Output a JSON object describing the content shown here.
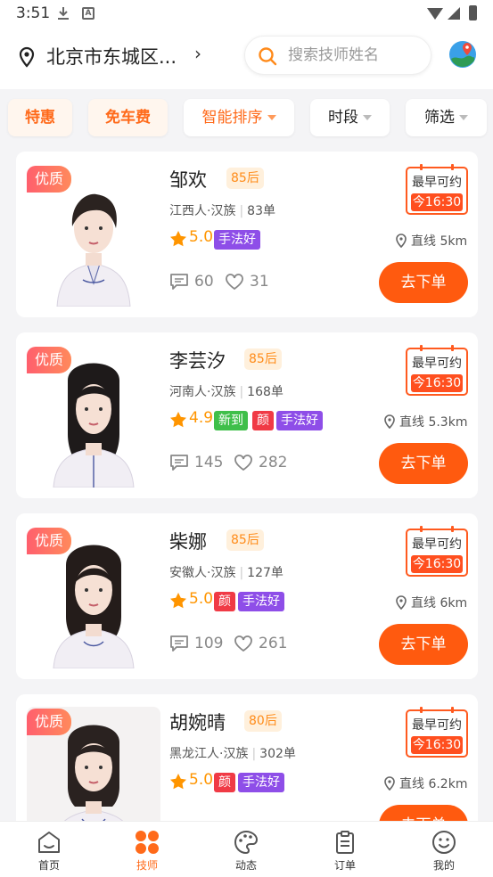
{
  "status_bar": {
    "time": "3:51"
  },
  "header": {
    "location": "北京市东城区...",
    "search_placeholder": "搜索技师姓名"
  },
  "filters": [
    {
      "label": "特惠",
      "type": "hot"
    },
    {
      "label": "免车费",
      "type": "hot"
    },
    {
      "label": "智能排序",
      "type": "sort"
    },
    {
      "label": "时段",
      "type": "dropdown"
    },
    {
      "label": "筛选",
      "type": "dropdown"
    }
  ],
  "colors": {
    "accent": "#ff5a0f",
    "star": "#ff9500",
    "purple_tag": "#8e4ee8",
    "red_tag": "#f03a45",
    "green_tag": "#3fbf4a"
  },
  "therapists": [
    {
      "badge": "优质",
      "name": "邹欢",
      "age_group": "85后",
      "origin": "江西人·汉族",
      "orders": "83单",
      "rating": "5.0",
      "tags": [
        {
          "text": "手法好",
          "color": "purple"
        }
      ],
      "avail_title": "最早可约",
      "avail_time": "今16:30",
      "distance": "直线 5km",
      "comments": "60",
      "likes": "31",
      "order_label": "去下单"
    },
    {
      "badge": "优质",
      "name": "李芸汐",
      "age_group": "85后",
      "origin": "河南人·汉族",
      "orders": "168单",
      "rating": "4.9",
      "tags": [
        {
          "text": "新到",
          "color": "green"
        },
        {
          "text": "颜",
          "color": "red"
        },
        {
          "text": "手法好",
          "color": "purple"
        }
      ],
      "avail_title": "最早可约",
      "avail_time": "今16:30",
      "distance": "直线 5.3km",
      "comments": "145",
      "likes": "282",
      "order_label": "去下单"
    },
    {
      "badge": "优质",
      "name": "柴娜",
      "age_group": "85后",
      "origin": "安徽人·汉族",
      "orders": "127单",
      "rating": "5.0",
      "tags": [
        {
          "text": "颜",
          "color": "red"
        },
        {
          "text": "手法好",
          "color": "purple"
        }
      ],
      "avail_title": "最早可约",
      "avail_time": "今16:30",
      "distance": "直线 6km",
      "comments": "109",
      "likes": "261",
      "order_label": "去下单"
    },
    {
      "badge": "优质",
      "name": "胡婉晴",
      "age_group": "80后",
      "origin": "黑龙江人·汉族",
      "orders": "302单",
      "rating": "5.0",
      "tags": [
        {
          "text": "颜",
          "color": "red"
        },
        {
          "text": "手法好",
          "color": "purple"
        }
      ],
      "avail_title": "最早可约",
      "avail_time": "今16:30",
      "distance": "直线 6.2km",
      "order_label": "去下单"
    }
  ],
  "tabbar": [
    {
      "label": "首页",
      "icon": "home-icon",
      "active": false
    },
    {
      "label": "技师",
      "icon": "therapist-grid-icon",
      "active": true
    },
    {
      "label": "动态",
      "icon": "palette-icon",
      "active": false
    },
    {
      "label": "订单",
      "icon": "clipboard-icon",
      "active": false
    },
    {
      "label": "我的",
      "icon": "smiley-icon",
      "active": false
    }
  ]
}
